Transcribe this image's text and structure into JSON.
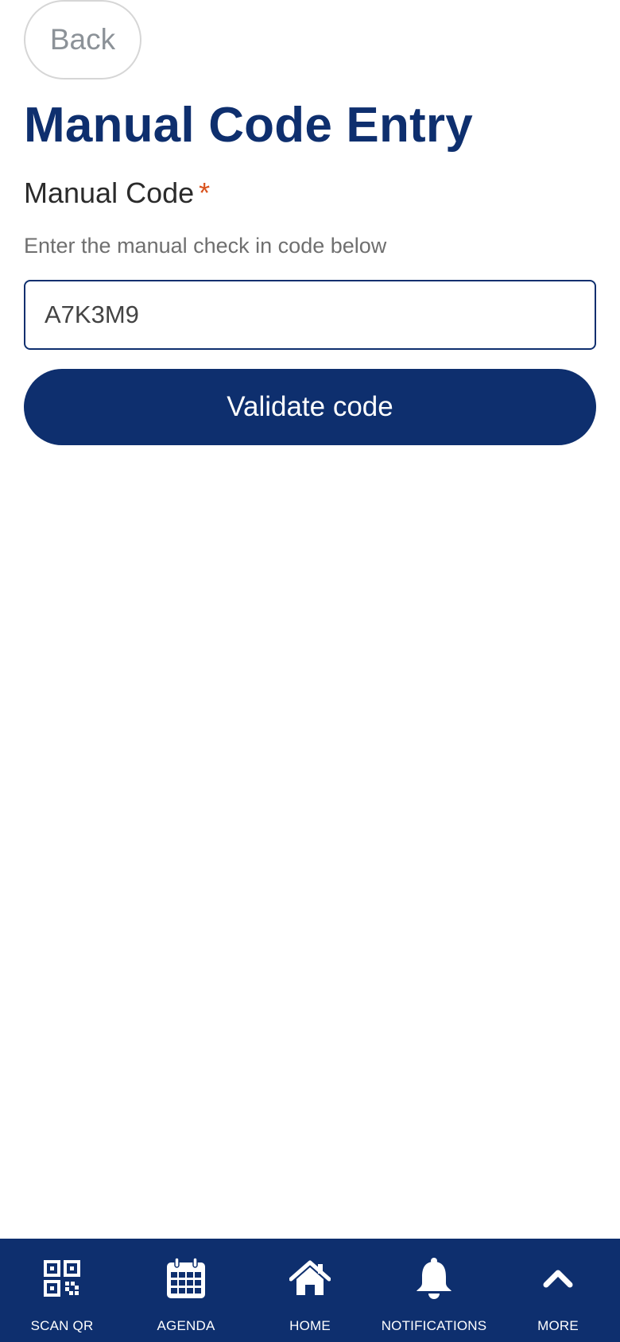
{
  "header": {
    "back_label": "Back",
    "title": "Manual Code Entry"
  },
  "form": {
    "field_label": "Manual Code",
    "required_mark": "*",
    "help_text": "Enter the manual check in code below",
    "code_value": "A7K3M9",
    "submit_label": "Validate code"
  },
  "bottom_nav": {
    "items": [
      {
        "label": "SCAN QR",
        "icon": "qr-code-icon"
      },
      {
        "label": "AGENDA",
        "icon": "calendar-icon"
      },
      {
        "label": "HOME",
        "icon": "home-icon"
      },
      {
        "label": "NOTIFICATIONS",
        "icon": "bell-icon"
      },
      {
        "label": "MORE",
        "icon": "chevron-up-icon"
      }
    ]
  },
  "colors": {
    "brand_navy": "#0e2f6e",
    "required_orange": "#d9531e",
    "back_border": "#d6d6d6",
    "back_text": "#8c9298"
  }
}
